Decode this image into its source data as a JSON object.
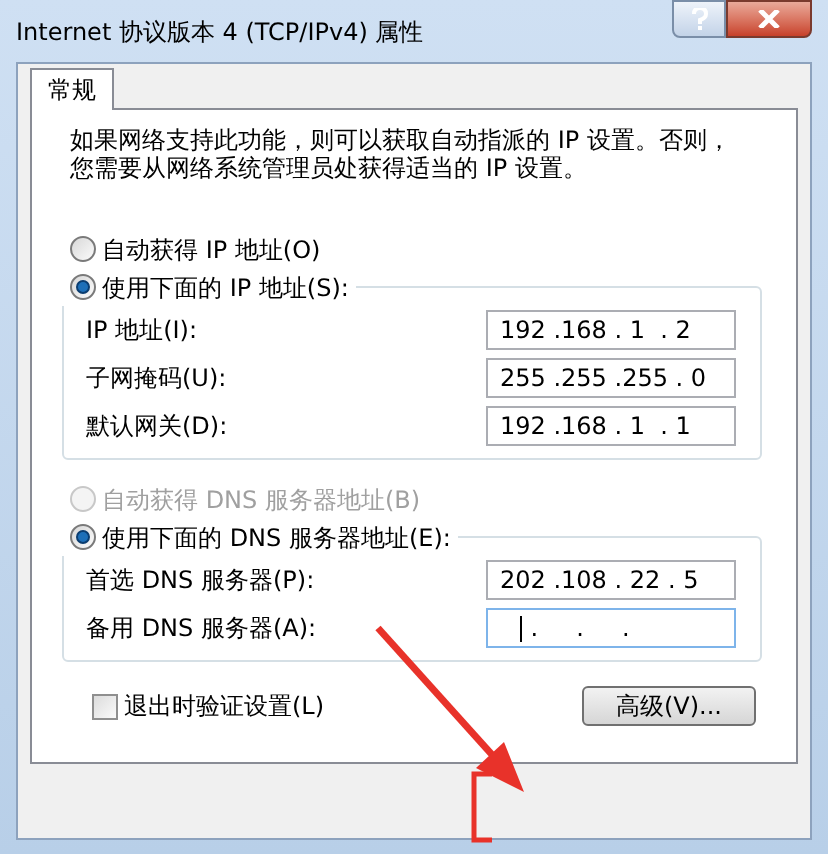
{
  "window": {
    "title": "Internet 协议版本 4 (TCP/IPv4) 属性"
  },
  "tabs": [
    {
      "label": "常规",
      "selected": true
    }
  ],
  "intro_lines": [
    "如果网络支持此功能，则可以获取自动指派的 IP 设置。否则，",
    "您需要从网络系统管理员处获得适当的 IP 设置。"
  ],
  "ip_options": [
    {
      "label": "自动获得 IP 地址(O)",
      "selected": false,
      "disabled": false
    },
    {
      "label": "使用下面的 IP 地址(S):",
      "selected": true,
      "disabled": false
    }
  ],
  "ip_fields": [
    {
      "label": "IP 地址(I):",
      "value": "192 .168 . 1  . 2",
      "focused": false
    },
    {
      "label": "子网掩码(U):",
      "value": "255 .255 .255 . 0",
      "focused": false
    },
    {
      "label": "默认网关(D):",
      "value": "192 .168 . 1  . 1",
      "focused": false
    }
  ],
  "dns_options": [
    {
      "label": "自动获得 DNS 服务器地址(B)",
      "selected": false,
      "disabled": true
    },
    {
      "label": "使用下面的 DNS 服务器地址(E):",
      "selected": true,
      "disabled": false
    }
  ],
  "dns_fields": [
    {
      "label": "首选 DNS 服务器(P):",
      "value": "202 .108 . 22 . 5",
      "focused": false
    },
    {
      "label": "备用 DNS 服务器(A):",
      "value": "    .     .     .",
      "focused": true
    }
  ],
  "validate_checkbox": {
    "label": "退出时验证设置(L)",
    "checked": false
  },
  "advanced_button": "高级(V)..."
}
